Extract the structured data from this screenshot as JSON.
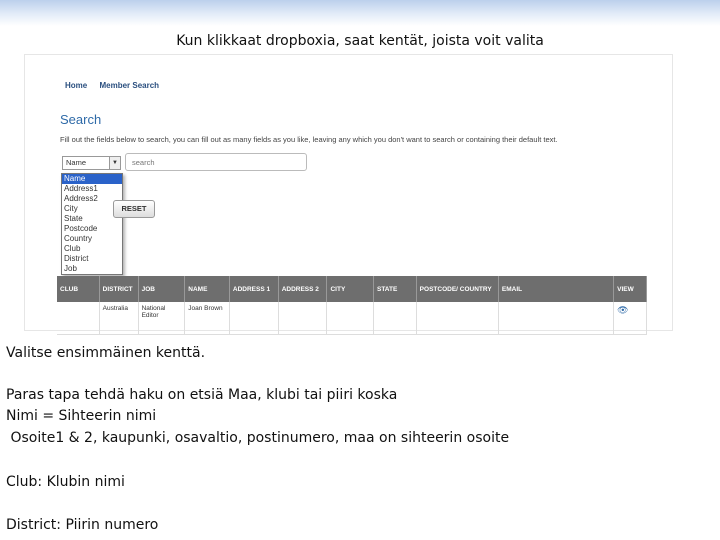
{
  "slide": {
    "title": "Kun klikkaat dropboxia, saat kentät, joista voit valita",
    "lines": [
      "Valitse ensimmäinen kenttä.",
      "Paras  tapa tehdä haku on etsiä Maa, klubi tai piiri koska",
      "Nimi =  Sihteerin nimi",
      " Osoite1 & 2, kaupunki, osavaltio, postinumero, maa on sihteerin osoite",
      "Club: Klubin nimi",
      "District:  Piirin numero"
    ]
  },
  "screenshot": {
    "nav": [
      "Home",
      "Member Search"
    ],
    "search_title": "Search",
    "instructions": "Fill out the fields below to search, you can fill out as many fields as you like, leaving any which you don't want to search or containing their default text.",
    "field_select_value": "Name",
    "search_placeholder": "search",
    "dropdown_options": [
      "Name",
      "Address1",
      "Address2",
      "City",
      "State",
      "Postcode",
      "Country",
      "Club",
      "District",
      "Job"
    ],
    "reset_label": "RESET",
    "table": {
      "columns": [
        "CLUB",
        "DISTRICT",
        "JOB",
        "NAME",
        "ADDRESS 1",
        "ADDRESS 2",
        "CITY",
        "STATE",
        "POSTCODE/ COUNTRY",
        "EMAIL",
        "VIEW"
      ],
      "row": {
        "district": "Australia",
        "job": "National Editor",
        "name": "Joan Brown"
      },
      "view_icon": "eye-icon"
    },
    "colors": {
      "selected": "#2a62c9",
      "header_bg": "#6e6e6e",
      "link": "#2e6aa8"
    }
  }
}
